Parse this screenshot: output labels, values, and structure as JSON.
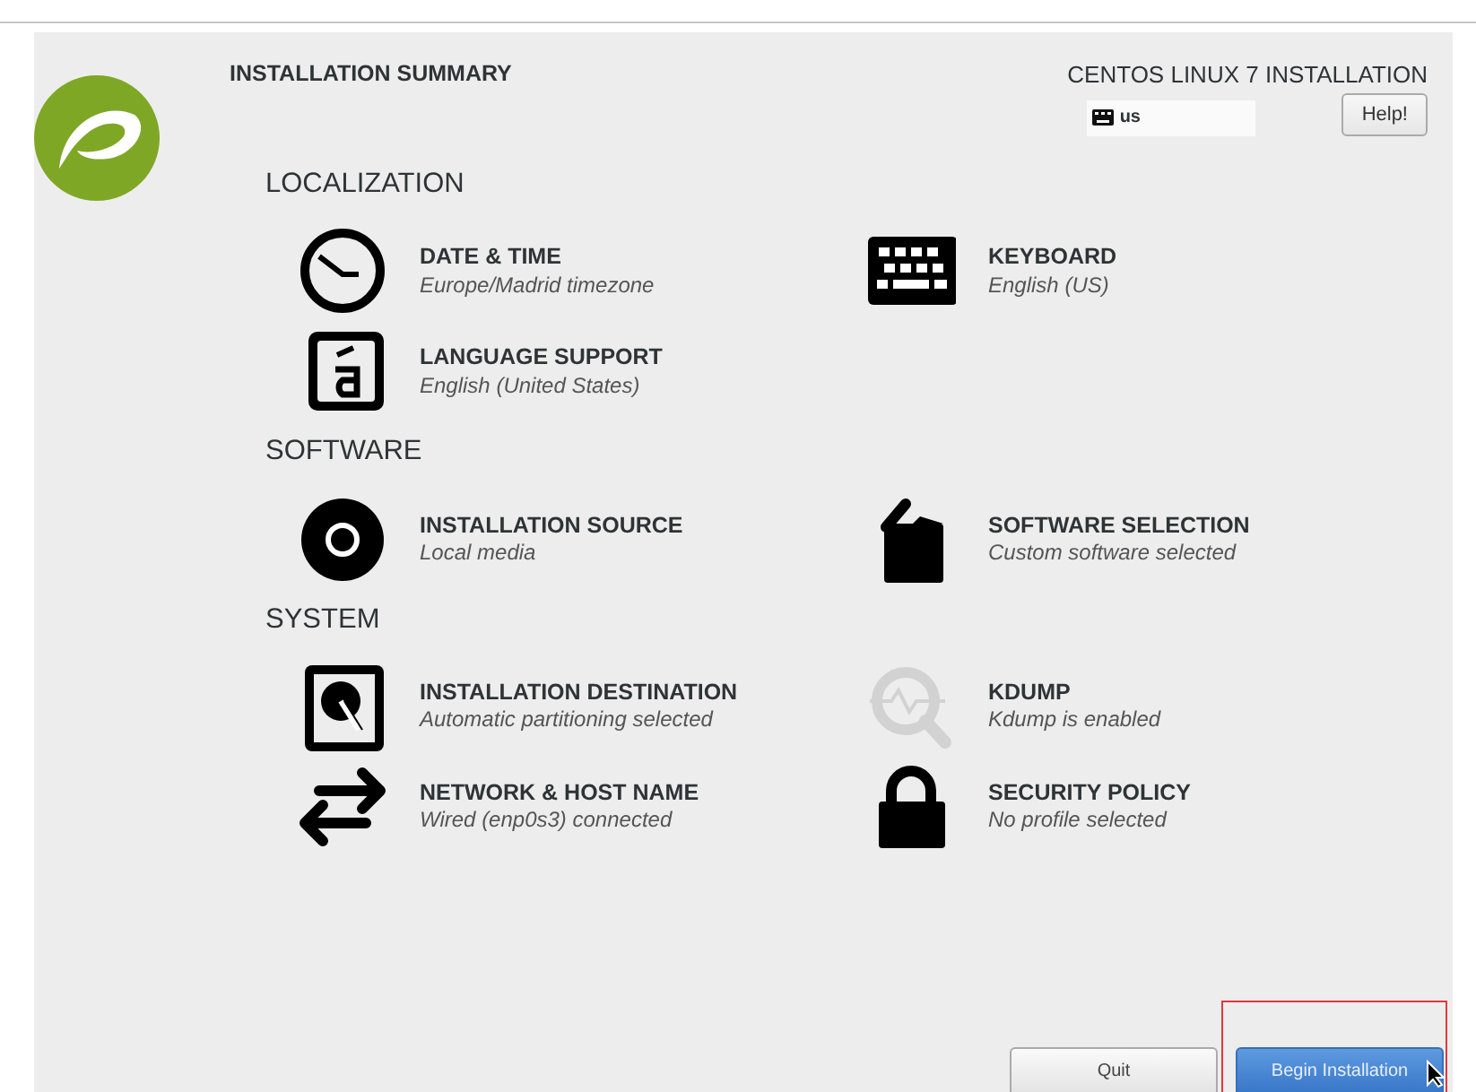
{
  "header": {
    "title": "INSTALLATION SUMMARY",
    "product": "CENTOS LINUX 7 INSTALLATION",
    "keyboard_layout": "us",
    "help_button": "Help!"
  },
  "sections": [
    {
      "title": "LOCALIZATION",
      "items": [
        {
          "title": "DATE & TIME",
          "status": "Europe/Madrid timezone",
          "dimmed": false
        },
        {
          "title": "KEYBOARD",
          "status": "English (US)",
          "dimmed": false
        },
        {
          "title": "LANGUAGE SUPPORT",
          "status": "English (United States)",
          "dimmed": false
        }
      ]
    },
    {
      "title": "SOFTWARE",
      "items": [
        {
          "title": "INSTALLATION SOURCE",
          "status": "Local media",
          "dimmed": false
        },
        {
          "title": "SOFTWARE SELECTION",
          "status": "Custom software selected",
          "dimmed": false
        }
      ]
    },
    {
      "title": "SYSTEM",
      "items": [
        {
          "title": "INSTALLATION DESTINATION",
          "status": "Automatic partitioning selected",
          "dimmed": false
        },
        {
          "title": "KDUMP",
          "status": "Kdump is enabled",
          "dimmed": true
        },
        {
          "title": "NETWORK & HOST NAME",
          "status": "Wired (enp0s3) connected",
          "dimmed": false
        },
        {
          "title": "SECURITY POLICY",
          "status": "No profile selected",
          "dimmed": false
        }
      ]
    }
  ],
  "footer": {
    "buttons": [
      {
        "label": "Quit",
        "kind": "secondary"
      },
      {
        "label": "Begin Installation",
        "kind": "primary",
        "highlighted": true
      }
    ]
  }
}
